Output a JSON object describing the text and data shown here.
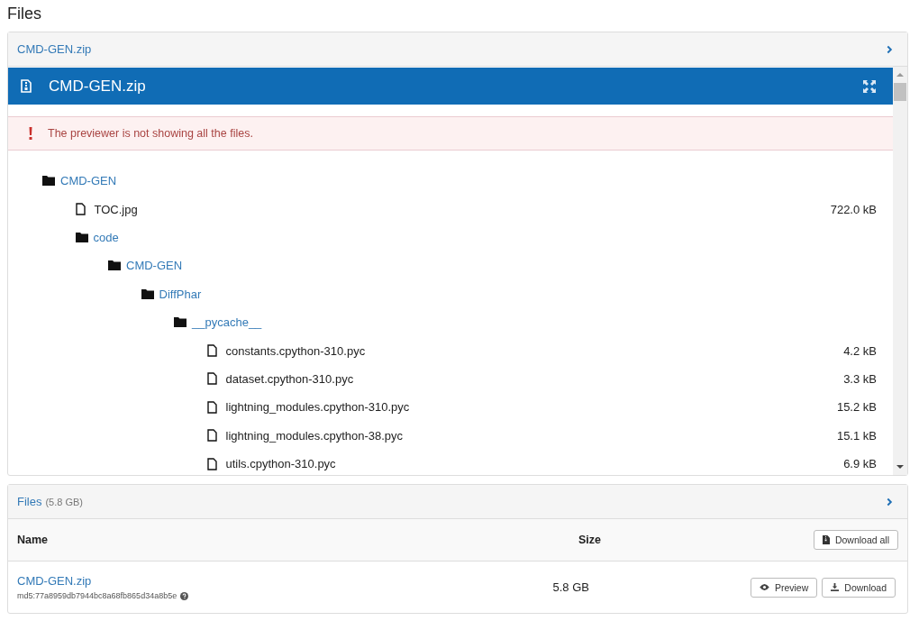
{
  "page_title": "Files",
  "preview_panel": {
    "header": "CMD-GEN.zip",
    "title": "CMD-GEN.zip",
    "alert": "The previewer is not showing all the files.",
    "tree": [
      {
        "kind": "folder",
        "name": "CMD-GEN",
        "children": [
          {
            "kind": "file",
            "name": "TOC.jpg",
            "size": "722.0 kB"
          },
          {
            "kind": "folder",
            "name": "code",
            "children": [
              {
                "kind": "folder",
                "name": "CMD-GEN",
                "children": [
                  {
                    "kind": "folder",
                    "name": "DiffPhar",
                    "children": [
                      {
                        "kind": "folder",
                        "name": "__pycache__",
                        "children": [
                          {
                            "kind": "file",
                            "name": "constants.cpython-310.pyc",
                            "size": "4.2 kB"
                          },
                          {
                            "kind": "file",
                            "name": "dataset.cpython-310.pyc",
                            "size": "3.3 kB"
                          },
                          {
                            "kind": "file",
                            "name": "lightning_modules.cpython-310.pyc",
                            "size": "15.2 kB"
                          },
                          {
                            "kind": "file",
                            "name": "lightning_modules.cpython-38.pyc",
                            "size": "15.1 kB"
                          },
                          {
                            "kind": "file",
                            "name": "utils.cpython-310.pyc",
                            "size": "6.9 kB"
                          }
                        ]
                      }
                    ]
                  }
                ]
              }
            ]
          }
        ]
      }
    ]
  },
  "files_panel": {
    "header": "Files",
    "total": "(5.8 GB)",
    "columns": [
      "Name",
      "Size"
    ],
    "download_all": "Download all",
    "rows": [
      {
        "name": "CMD-GEN.zip",
        "checksum": "md5:77a8959db7944bc8a68fb865d34a8b5e",
        "size": "5.8 GB",
        "preview": "Preview",
        "download": "Download"
      }
    ]
  }
}
